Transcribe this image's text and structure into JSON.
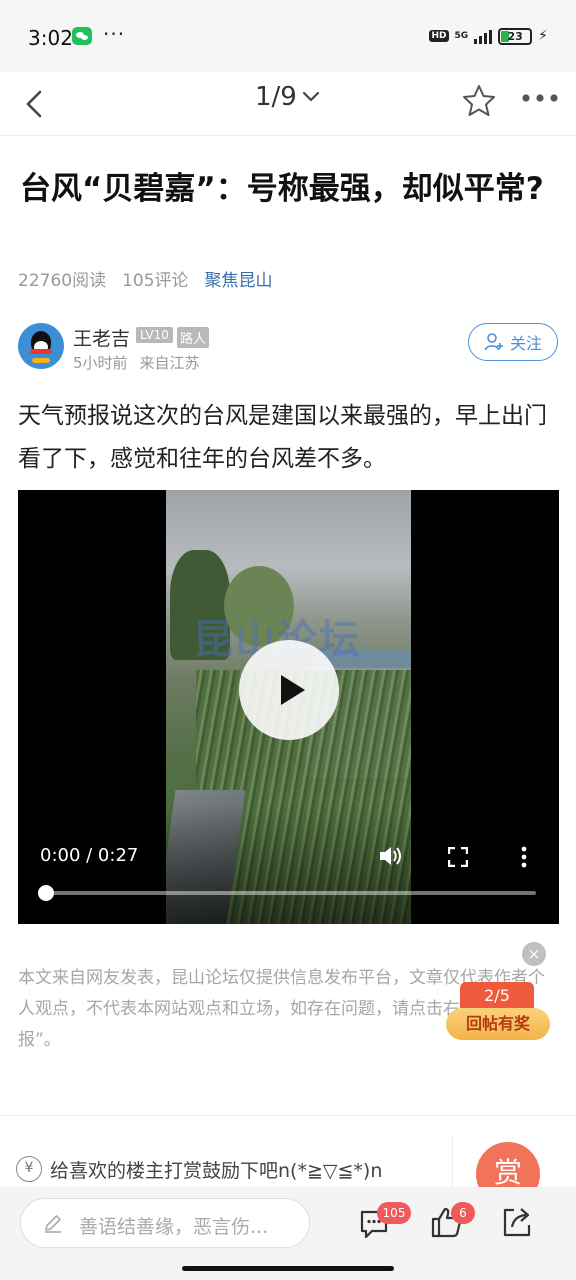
{
  "status_bar": {
    "time": "3:02",
    "dots": "···",
    "hd": "HD",
    "network": "5G",
    "battery": "23"
  },
  "nav": {
    "page_indicator": "1/9"
  },
  "post": {
    "title": "台风“贝碧嘉”：号称最强，却似平常?",
    "reads": "22760阅读",
    "comments": "105评论",
    "forum": "聚焦昆山",
    "author": {
      "name": "王老吉",
      "level": "LV10",
      "role": "路人",
      "time": "5小时前",
      "location": "来自江苏"
    },
    "follow_label": "关注",
    "body": "天气预报说这次的台风是建国以来最强的，早上出门看了下，感觉和往年的台风差不多。",
    "video": {
      "time": "0:00 / 0:27",
      "progress": 0,
      "watermark": "昆山论坛"
    },
    "disclaimer": "本文来自网友发表，昆山论坛仅提供信息发布平台，文章仅代表作者个人观点，不代表本网站观点和立场，如存在问题，请点击右上角“举报”。"
  },
  "reward_float": {
    "close": "×",
    "count": "2/5",
    "label": "回帖有奖"
  },
  "reward_bar": {
    "yen": "¥",
    "text": "给喜欢的楼主打赏鼓励下吧n(*≧▽≦*)n",
    "button": "赏"
  },
  "bottom_bar": {
    "placeholder": "善语结善缘，恶言伤...",
    "comment_count": "105",
    "like_count": "6"
  },
  "colors": {
    "accent_blue": "#4a90d9",
    "forum_blue": "#3b6eb0",
    "reward_red": "#f2735a",
    "badge_red": "#ef5a5a"
  }
}
